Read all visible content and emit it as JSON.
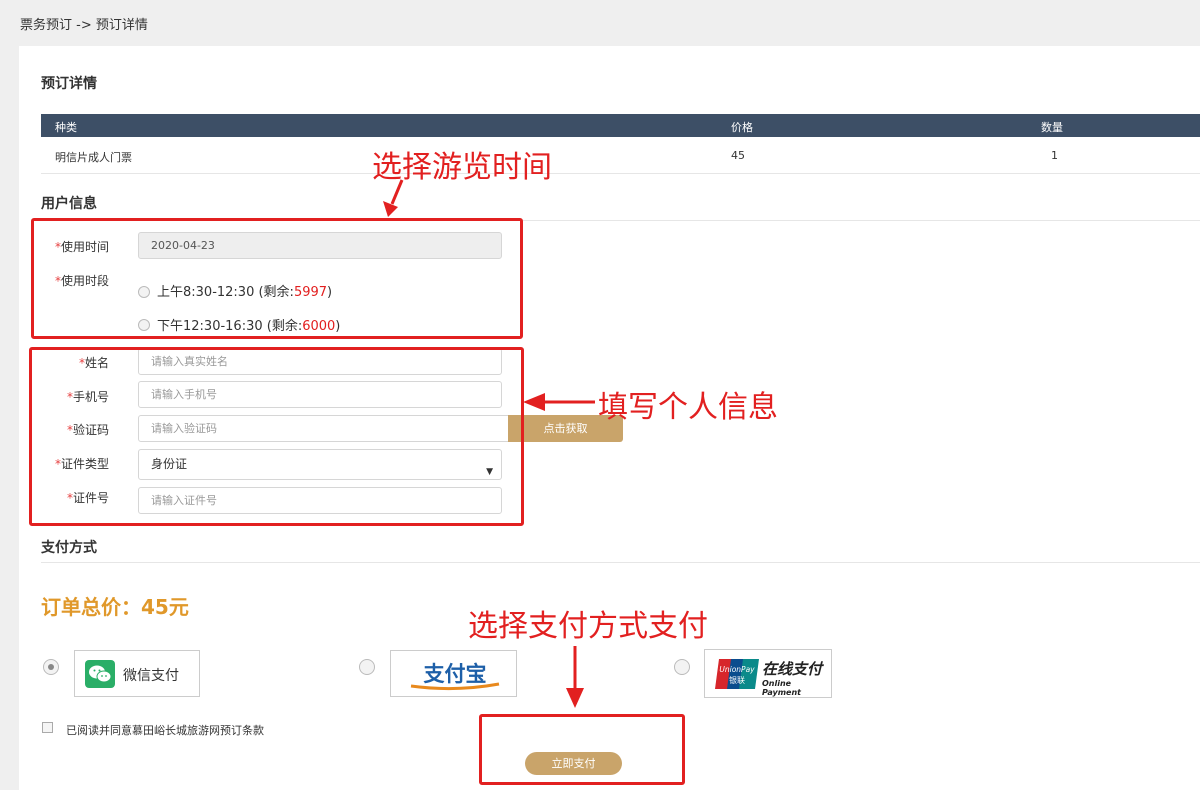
{
  "breadcrumb": "票务预订 -> 预订详情",
  "booking": {
    "title": "预订详情",
    "columns": [
      "种类",
      "价格",
      "数量"
    ],
    "row": {
      "type": "明信片成人门票",
      "price": "45",
      "qty": "1"
    }
  },
  "user_info": {
    "title": "用户信息",
    "required_mark": "*",
    "date_label": "使用时间",
    "date_value": "2020-04-23",
    "slot_label": "使用时段",
    "slots": [
      {
        "text": "上午8:30-12:30 (剩余:",
        "remaining": "5997",
        "close": ")"
      },
      {
        "text": "下午12:30-16:30 (剩余:",
        "remaining": "6000",
        "close": ")"
      }
    ],
    "name_label": "姓名",
    "name_placeholder": "请输入真实姓名",
    "phone_label": "手机号",
    "phone_placeholder": "请输入手机号",
    "code_label": "验证码",
    "code_placeholder": "请输入验证码",
    "get_code": "点击获取",
    "id_type_label": "证件类型",
    "id_type_value": "身份证",
    "id_no_label": "证件号",
    "id_no_placeholder": "请输入证件号"
  },
  "payment": {
    "title": "支付方式",
    "total": "订单总价：45元",
    "methods": [
      {
        "label": "微信支付",
        "icon": "wechat-pay-icon"
      },
      {
        "label": "支付宝",
        "icon": "alipay-logo"
      },
      {
        "label": "在线支付",
        "sublabel": "Online Payment",
        "icon": "unionpay-logo",
        "logo_text": "UnionPay",
        "logo_sub": "银联"
      }
    ],
    "agree": "已阅读并同意慕田峪长城旅游网预订条款",
    "pay_button": "立即支付"
  },
  "annotations": {
    "choose_time": "选择游览时间",
    "fill_info": "填写个人信息",
    "choose_pay": "选择支付方式支付"
  },
  "colors": {
    "header": "#3d4f66",
    "gold": "#c9a46a",
    "total": "#e0982a",
    "annotation": "#e22020"
  }
}
